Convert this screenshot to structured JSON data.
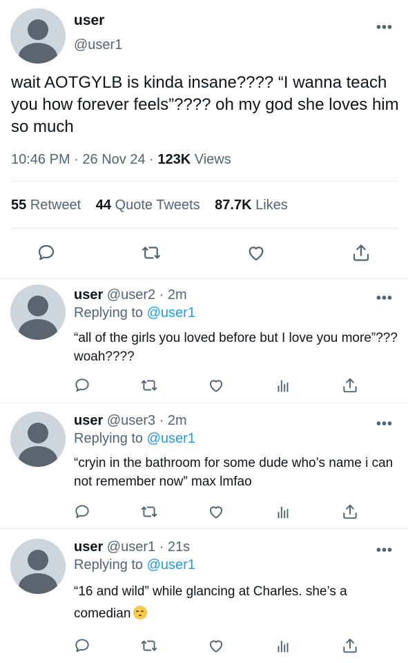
{
  "main_tweet": {
    "name": "user",
    "handle": "@user1",
    "more_icon": "•••",
    "text": "wait AOTGYLB is kinda insane???? “I wanna teach you how forever feels”???? oh my god she loves him so much",
    "time": "10:46 PM",
    "sep1": " · ",
    "date": "26 Nov 24",
    "sep2": " · ",
    "views_count": "123K",
    "views_label": " Views",
    "retweets_count": "55",
    "retweets_label": " Retweet",
    "quotes_count": "44",
    "quotes_label": " Quote Tweets",
    "likes_count": "87.7K",
    "likes_label": " Likes"
  },
  "replies": [
    {
      "name": "user",
      "handle": " @user2",
      "time": " · 2m",
      "replying_prefix": "Replying to ",
      "replying_to": "@user1",
      "text": "“all of the girls you loved before but I love you more”??? woah????",
      "more_icon": "•••"
    },
    {
      "name": "user",
      "handle": " @user3",
      "time": " · 2m",
      "replying_prefix": "Replying to ",
      "replying_to": "@user1",
      "text": "“cryin in the bathroom for some dude who’s name i can not remember now” max lmfao",
      "more_icon": "•••"
    },
    {
      "name": "user",
      "handle": " @user1",
      "time": " · 21s",
      "replying_prefix": "Replying to ",
      "replying_to": "@user1",
      "text": "“16 and wild” while glancing at Charles. she’s a comedian",
      "more_icon": "•••"
    }
  ],
  "icons": {
    "reply": "reply-icon",
    "retweet": "retweet-icon",
    "like": "heart-icon",
    "analytics": "analytics-icon",
    "share": "share-icon",
    "emoji": "smirking-face-emoji"
  },
  "colors": {
    "text": "#0f1419",
    "secondary": "#536471",
    "link": "#1d9bf0",
    "divider": "#e6e9ec",
    "avatar_bg": "#cdd5dd",
    "avatar_fg": "#5b6570"
  }
}
